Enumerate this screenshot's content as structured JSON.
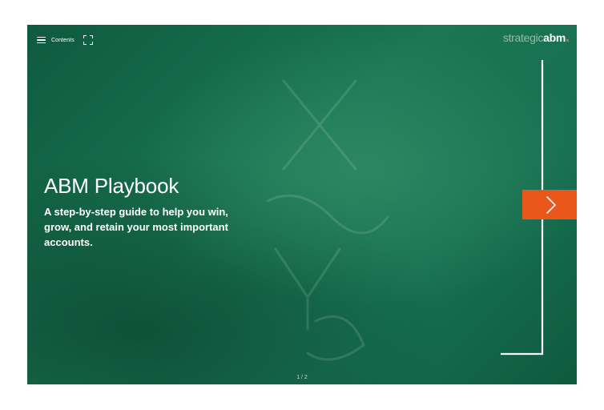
{
  "toolbar": {
    "contents_label": "Contents"
  },
  "brand": {
    "logo_part1": "strategic",
    "logo_part2": "abm",
    "accent_color": "#e9581a",
    "background_color": "#177052"
  },
  "hero": {
    "title": "ABM Playbook",
    "subtitle": "A step-by-step guide to help you win, grow, and retain your most important accounts."
  },
  "navigation": {
    "next_icon": "chevron-right-icon",
    "page_indicator": "1 / 2"
  },
  "icons": {
    "menu": "hamburger-menu-icon",
    "fullscreen": "fullscreen-icon"
  }
}
